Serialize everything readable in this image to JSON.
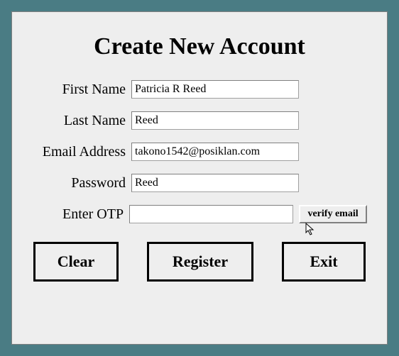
{
  "title": "Create New Account",
  "fields": {
    "first_name": {
      "label": "First Name",
      "value": "Patricia R Reed"
    },
    "last_name": {
      "label": "Last Name",
      "value": "Reed"
    },
    "email": {
      "label": "Email Address",
      "value": "takono1542@posiklan.com"
    },
    "password": {
      "label": "Password",
      "value": "Reed"
    },
    "otp": {
      "label": "Enter OTP",
      "value": ""
    }
  },
  "buttons": {
    "verify_email": "verify email",
    "clear": "Clear",
    "register": "Register",
    "exit": "Exit"
  }
}
